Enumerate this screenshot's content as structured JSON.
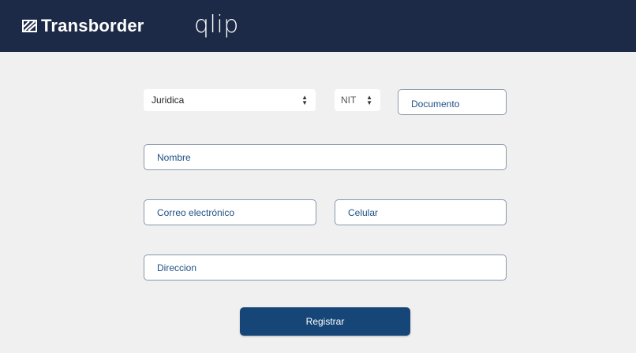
{
  "header": {
    "brand": "Transborder",
    "product": "qlip",
    "background": "#1d2a47"
  },
  "form": {
    "person_type": "Juridica",
    "doc_type": "NIT",
    "documento_placeholder": "Documento",
    "nombre_placeholder": "Nombre",
    "correo_placeholder": "Correo electrónico",
    "celular_placeholder": "Celular",
    "direccion_placeholder": "Direccion",
    "submit_label": "Registrar",
    "button_color": "#164677"
  }
}
